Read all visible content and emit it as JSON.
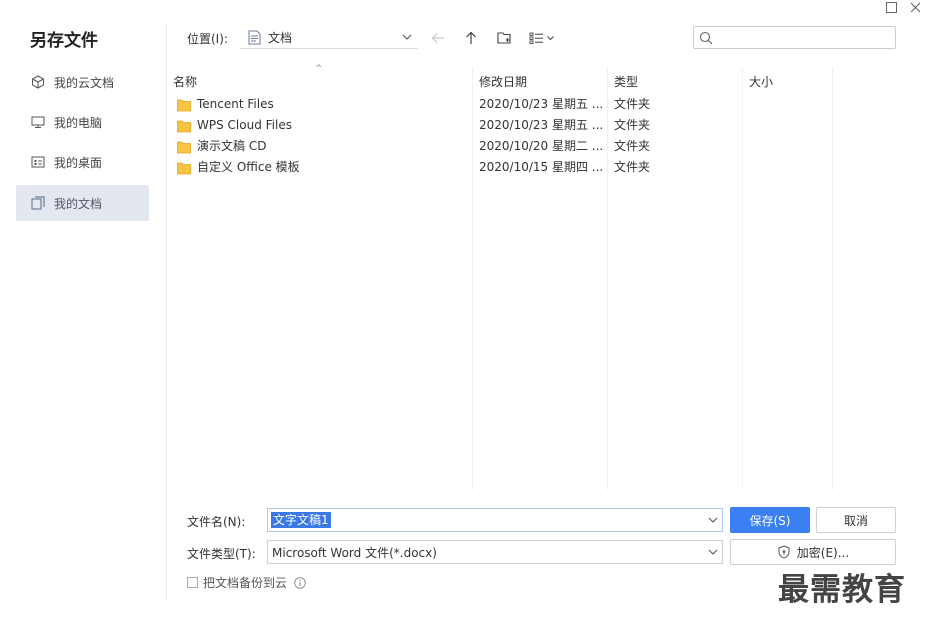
{
  "window": {
    "title": "另存文件"
  },
  "sidebar": {
    "items": [
      {
        "label": "我的云文档",
        "icon": "cloud-cube-icon",
        "active": false
      },
      {
        "label": "我的电脑",
        "icon": "monitor-icon",
        "active": false
      },
      {
        "label": "我的桌面",
        "icon": "desktop-icon",
        "active": false
      },
      {
        "label": "我的文档",
        "icon": "folder-doc-icon",
        "active": true
      }
    ]
  },
  "toolbar": {
    "location_label": "位置(I):",
    "location_value": "文档",
    "search_placeholder": ""
  },
  "file_list": {
    "columns": [
      "名称",
      "修改日期",
      "类型",
      "大小"
    ],
    "rows": [
      {
        "name": "Tencent Files",
        "date": "2020/10/23 星期五 ...",
        "type": "文件夹",
        "size": ""
      },
      {
        "name": "WPS Cloud Files",
        "date": "2020/10/23 星期五 ...",
        "type": "文件夹",
        "size": ""
      },
      {
        "name": "演示文稿 CD",
        "date": "2020/10/20 星期二 ...",
        "type": "文件夹",
        "size": ""
      },
      {
        "name": "自定义 Office 模板",
        "date": "2020/10/15 星期四 ...",
        "type": "文件夹",
        "size": ""
      }
    ]
  },
  "form": {
    "filename_label": "文件名(N):",
    "filename_value": "文字文稿1",
    "filetype_label": "文件类型(T):",
    "filetype_value": "Microsoft Word 文件(*.docx)",
    "save_label": "保存(S)",
    "cancel_label": "取消",
    "encrypt_label": "加密(E)...",
    "backup_label": "把文档备份到云"
  },
  "watermark": "最需教育",
  "colors": {
    "accent": "#3b7ff4",
    "selection": "#3b78e7",
    "sidebar_active": "#e3e7ef",
    "folder": "#f5c242"
  }
}
